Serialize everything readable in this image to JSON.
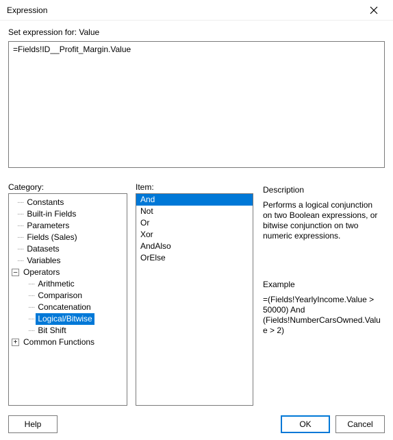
{
  "window": {
    "title": "Expression"
  },
  "prompt": "Set expression for: Value",
  "expression_value": "=Fields!ID__Profit_Margin.Value",
  "labels": {
    "category": "Category:",
    "item": "Item:",
    "description": "Description",
    "example": "Example"
  },
  "category_tree": {
    "top": [
      "Constants",
      "Built-in Fields",
      "Parameters",
      "Fields (Sales)",
      "Datasets",
      "Variables"
    ],
    "operators_label": "Operators",
    "operators_children": [
      "Arithmetic",
      "Comparison",
      "Concatenation",
      "Logical/Bitwise",
      "Bit Shift"
    ],
    "selected_child": "Logical/Bitwise",
    "common_functions_label": "Common Functions"
  },
  "items": [
    "And",
    "Not",
    "Or",
    "Xor",
    "AndAlso",
    "OrElse"
  ],
  "selected_item": "And",
  "description_text": "Performs a logical conjunction on two Boolean expressions, or bitwise conjunction on two numeric expressions.",
  "example_text": "=(Fields!YearlyIncome.Value > 50000) And (Fields!NumberCarsOwned.Value > 2)",
  "buttons": {
    "help": "Help",
    "ok": "OK",
    "cancel": "Cancel"
  }
}
